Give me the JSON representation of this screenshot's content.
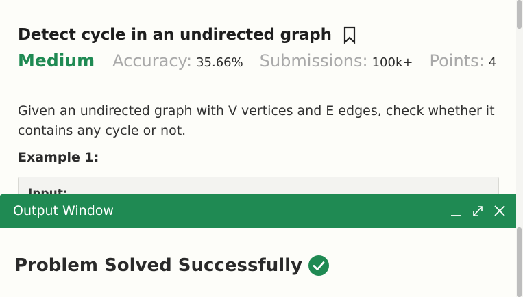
{
  "problem": {
    "title": "Detect cycle in an undirected graph",
    "difficulty": "Medium",
    "accuracy_label": "Accuracy:",
    "accuracy_value": "35.66%",
    "submissions_label": "Submissions:",
    "submissions_value": "100k+",
    "points_label": "Points:",
    "points_value": "4",
    "description": "Given an undirected graph with V vertices and E edges, check whether it contains any cycle or not.",
    "example_heading": "Example 1:",
    "example_text": "Input:"
  },
  "output_window": {
    "title": "Output Window",
    "status": "Problem Solved Successfully"
  },
  "colors": {
    "accent": "#1f8a53",
    "muted": "#a9a9a9"
  },
  "icons": {
    "bookmark": "bookmark-icon",
    "minimize": "minimize-icon",
    "expand": "expand-icon",
    "close": "close-icon",
    "success": "check-circle-icon"
  }
}
